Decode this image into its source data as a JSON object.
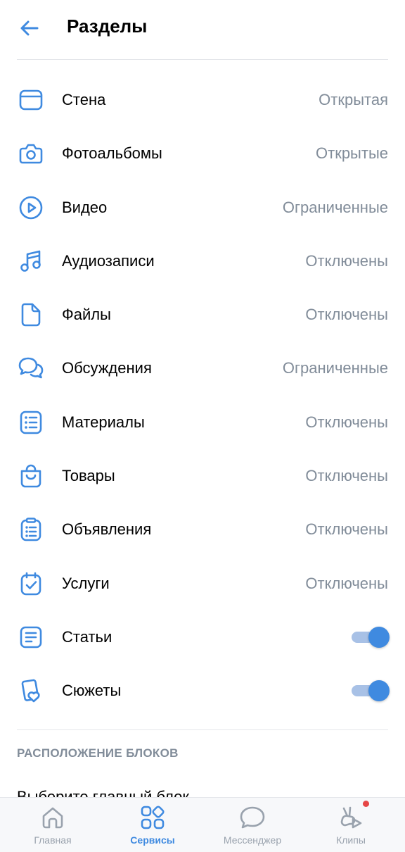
{
  "header": {
    "title": "Разделы",
    "back_icon": "arrow-left-icon"
  },
  "colors": {
    "accent": "#3f8ae0",
    "muted": "#818c99",
    "text": "#000000",
    "tab_inactive": "#99a2ad",
    "badge": "#e64646"
  },
  "sections": [
    {
      "label": "Стена",
      "value": "Открытая",
      "icon": "wall-icon"
    },
    {
      "label": "Фотоальбомы",
      "value": "Открытые",
      "icon": "camera-icon"
    },
    {
      "label": "Видео",
      "value": "Ограниченные",
      "icon": "play-icon"
    },
    {
      "label": "Аудиозаписи",
      "value": "Отключены",
      "icon": "music-note-icon"
    },
    {
      "label": "Файлы",
      "value": "Отключены",
      "icon": "document-icon"
    },
    {
      "label": "Обсуждения",
      "value": "Ограниченные",
      "icon": "discussions-icon"
    },
    {
      "label": "Материалы",
      "value": "Отключены",
      "icon": "list-icon"
    },
    {
      "label": "Товары",
      "value": "Отключены",
      "icon": "shopping-bag-icon"
    },
    {
      "label": "Объявления",
      "value": "Отключены",
      "icon": "clipboard-list-icon"
    },
    {
      "label": "Услуги",
      "value": "Отключены",
      "icon": "calendar-check-icon"
    },
    {
      "label": "Статьи",
      "toggle": true,
      "icon": "article-icon"
    },
    {
      "label": "Сюжеты",
      "toggle": true,
      "icon": "stories-heart-icon"
    }
  ],
  "blocks": {
    "header": "РАСПОЛОЖЕНИЕ БЛОКОВ",
    "main_block_label": "Выберите главный блок"
  },
  "tabbar": {
    "tabs": [
      {
        "label": "Главная",
        "icon": "home-icon",
        "active": false
      },
      {
        "label": "Сервисы",
        "icon": "services-grid-icon",
        "active": true
      },
      {
        "label": "Мессенджер",
        "icon": "message-bubble-icon",
        "active": false
      },
      {
        "label": "Клипы",
        "icon": "clips-icon",
        "active": false,
        "badge": true
      }
    ]
  }
}
